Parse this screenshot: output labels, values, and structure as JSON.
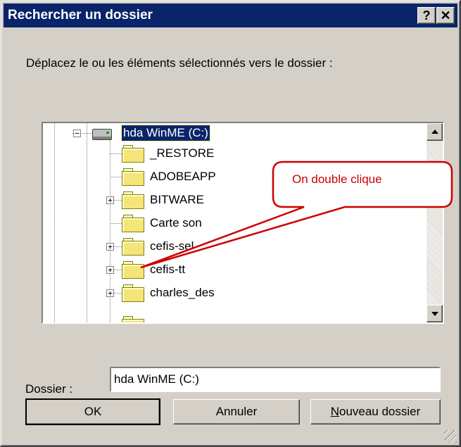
{
  "dialog": {
    "title": "Rechercher un dossier",
    "help_label": "?",
    "close_label": "✕",
    "prompt": "Déplacez le ou les éléments sélectionnés vers le dossier :"
  },
  "tree": {
    "root": {
      "label": "hda WinME (C:)",
      "icon": "drive-icon",
      "expanded": true,
      "selected": true
    },
    "items": [
      {
        "label": "_RESTORE",
        "has_children": false
      },
      {
        "label": "ADOBEAPP",
        "has_children": false
      },
      {
        "label": "BITWARE",
        "has_children": true
      },
      {
        "label": "Carte son",
        "has_children": false
      },
      {
        "label": "cefis-sel",
        "has_children": true
      },
      {
        "label": "cefis-tt",
        "has_children": true
      },
      {
        "label": "charles_des",
        "has_children": true
      }
    ]
  },
  "folder_field": {
    "label": "Dossier :",
    "value": "hda WinME (C:)"
  },
  "buttons": {
    "ok": "OK",
    "cancel": "Annuler",
    "new_folder_mnemonic": "N",
    "new_folder_rest": "ouveau dossier"
  },
  "annotation": {
    "text": "On double clique",
    "color": "#cc0000"
  },
  "colors": {
    "titlebar": "#0a246a",
    "selection": "#0a246a",
    "face": "#d4d0c8",
    "folder": "#f5e47a"
  }
}
